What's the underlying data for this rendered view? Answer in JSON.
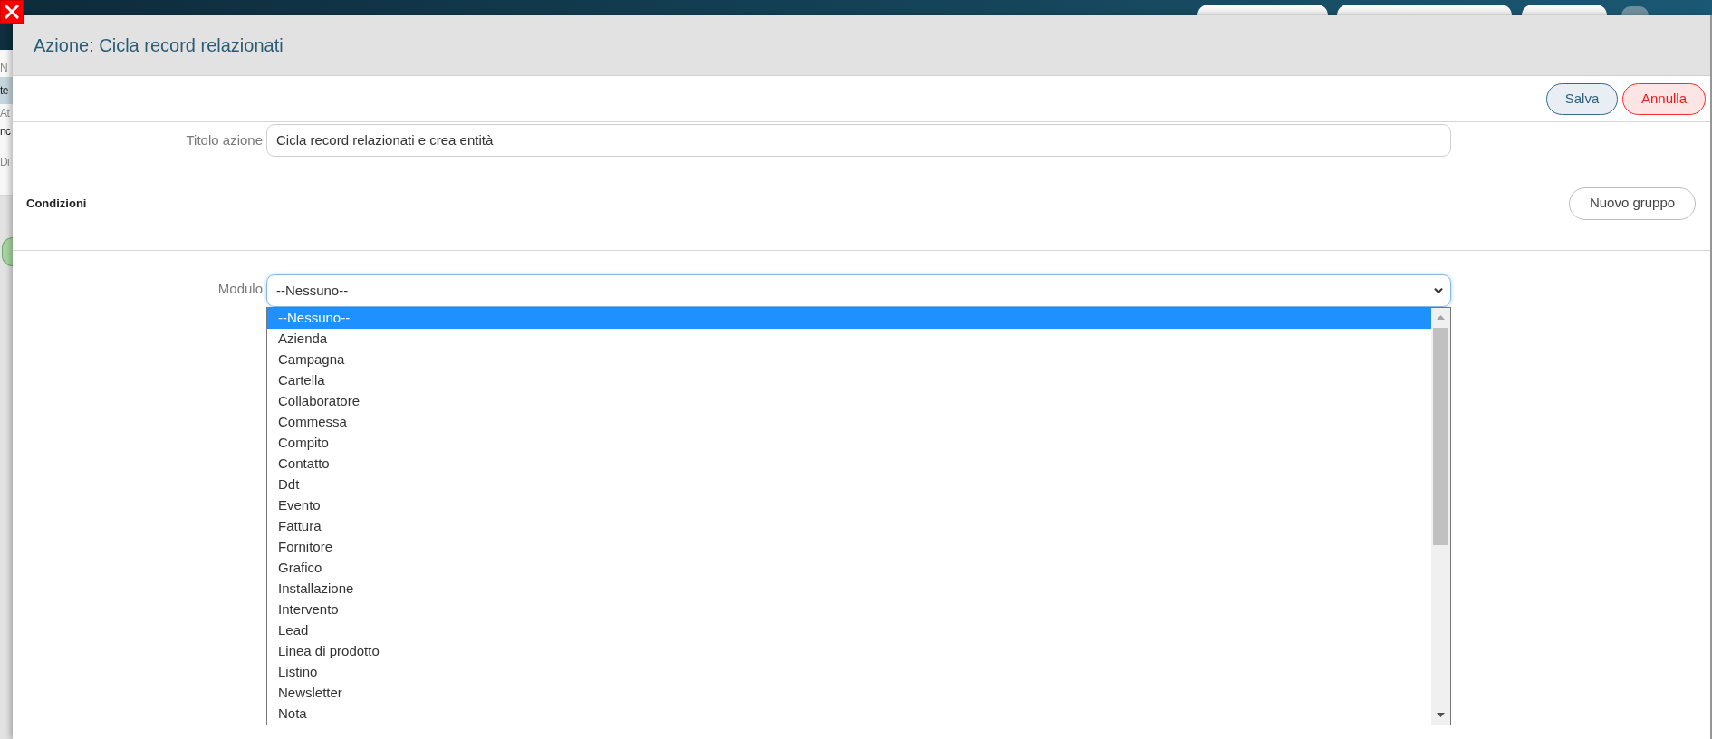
{
  "background_page": {
    "items": [
      {
        "kind": "label",
        "text": "N",
        "selected": false
      },
      {
        "kind": "value",
        "text": "te",
        "selected": true
      },
      {
        "kind": "label",
        "text": "At",
        "selected": false
      },
      {
        "kind": "value",
        "text": "nc",
        "selected": false
      },
      {
        "kind": "label",
        "text": "Di",
        "selected": false
      }
    ]
  },
  "dialog": {
    "title": "Azione: Cicla record relazionati",
    "buttons": [
      {
        "label": "Salva",
        "kind": "primary"
      },
      {
        "label": "Annulla",
        "kind": "cancel"
      }
    ],
    "fields": [
      {
        "label": "Titolo azione",
        "value": "Cicla record relazionati e crea entità"
      }
    ],
    "conditions": {
      "title": "Condizioni",
      "button": "Nuovo gruppo"
    },
    "module_select": {
      "label": "Modulo",
      "value": "--Nessuno--",
      "expanded": true,
      "options": [
        {
          "label": "--Nessuno--",
          "selected": true
        },
        {
          "label": "Azienda",
          "selected": false
        },
        {
          "label": "Campagna",
          "selected": false
        },
        {
          "label": "Cartella",
          "selected": false
        },
        {
          "label": "Collaboratore",
          "selected": false
        },
        {
          "label": "Commessa",
          "selected": false
        },
        {
          "label": "Compito",
          "selected": false
        },
        {
          "label": "Contatto",
          "selected": false
        },
        {
          "label": "Ddt",
          "selected": false
        },
        {
          "label": "Evento",
          "selected": false
        },
        {
          "label": "Fattura",
          "selected": false
        },
        {
          "label": "Fornitore",
          "selected": false
        },
        {
          "label": "Grafico",
          "selected": false
        },
        {
          "label": "Installazione",
          "selected": false
        },
        {
          "label": "Intervento",
          "selected": false
        },
        {
          "label": "Lead",
          "selected": false
        },
        {
          "label": "Linea di prodotto",
          "selected": false
        },
        {
          "label": "Listino",
          "selected": false
        },
        {
          "label": "Newsletter",
          "selected": false
        },
        {
          "label": "Nota",
          "selected": false
        }
      ]
    }
  }
}
